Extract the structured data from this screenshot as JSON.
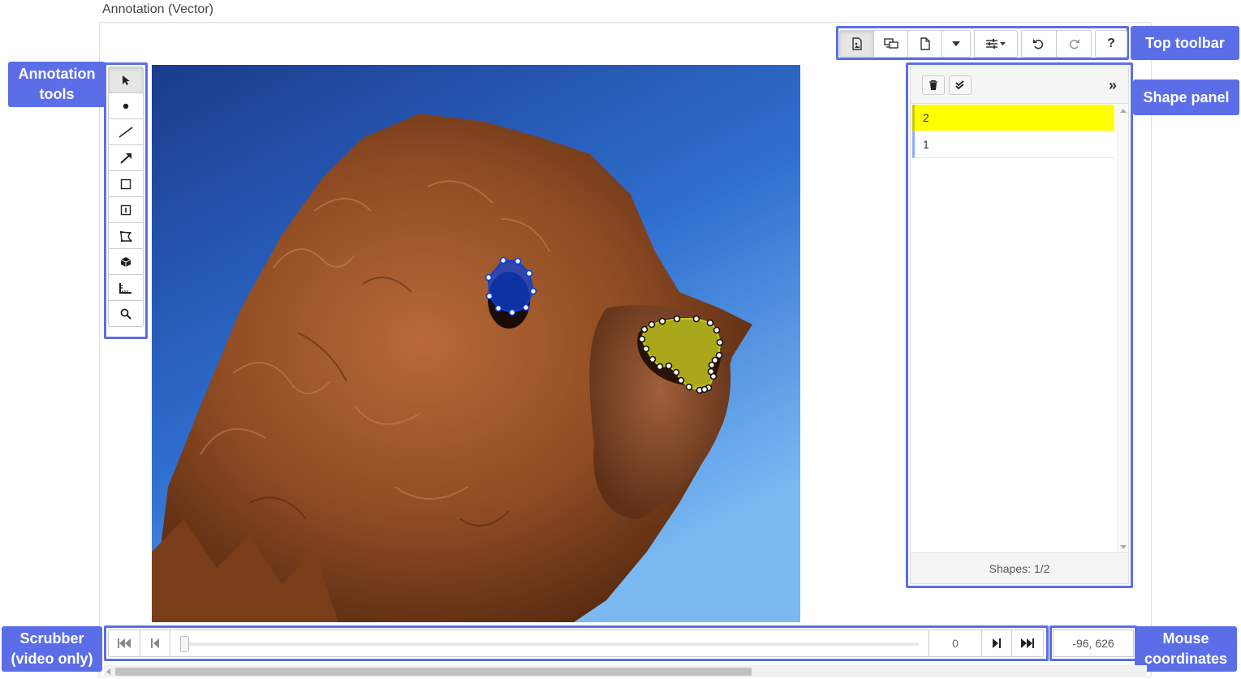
{
  "title": "Annotation (Vector)",
  "callouts": {
    "annotation_tools": "Annotation tools",
    "top_toolbar": "Top toolbar",
    "shape_panel": "Shape panel",
    "scrubber": "Scrubber (video only)",
    "mouse_coordinates": "Mouse coordinates"
  },
  "toolbar": {
    "icons": [
      "image-icon",
      "screens-icon",
      "file-icon",
      "caret-down-icon",
      "sliders-icon",
      "undo-icon",
      "redo-icon"
    ],
    "help_label": "?"
  },
  "tools": [
    "pointer-icon",
    "point-icon",
    "line-icon",
    "arrow-icon",
    "rectangle-icon",
    "text-box-icon",
    "polygon-icon",
    "cube-icon",
    "ruler-icon",
    "search-icon"
  ],
  "shape_panel": {
    "collapse_label": "»",
    "shapes": [
      {
        "label": "2",
        "color": "#ffff00",
        "selected": true
      },
      {
        "label": "1",
        "color": "#0000ff",
        "selected": false
      }
    ],
    "footer": "Shapes: 1/2"
  },
  "scrubber": {
    "frame": "0",
    "progress": 0
  },
  "mouse_coordinates": "-96, 626",
  "colors": {
    "accent": "#5b6ee8",
    "eye_shape": "#0b3fd6",
    "nose_shape": "#c8c81e"
  }
}
